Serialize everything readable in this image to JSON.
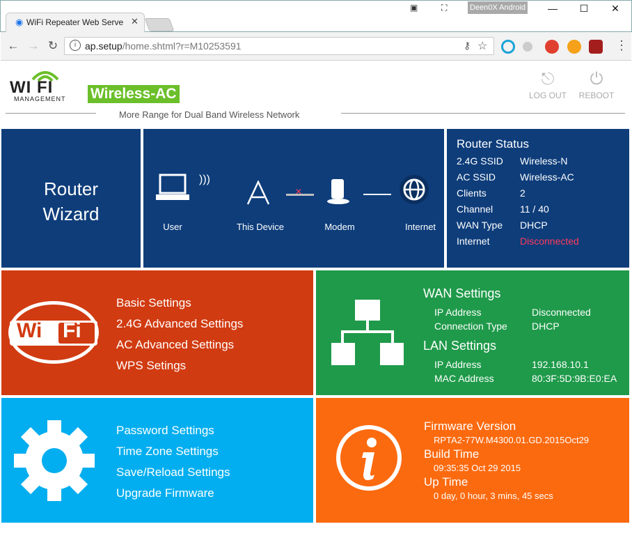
{
  "browser": {
    "tab_title": "WiFi Repeater Web Serve",
    "profile": "Deen0X Android",
    "url_host": "ap.setup",
    "url_path": "/home.shtml?r=M10253591",
    "minimize": "—",
    "maximize": "☐",
    "close": "✕"
  },
  "header": {
    "logo_text": "WI FI",
    "logo_sub": "MANAGEMENT",
    "badge": "Wireless-AC",
    "tagline": "More Range for Dual Band Wireless Network",
    "logout_label": "LOG OUT",
    "reboot_label": "REBOOT"
  },
  "wizard": {
    "line1": "Router",
    "line2": "Wizard"
  },
  "topology": {
    "user": "User",
    "device": "This Device",
    "modem": "Modem",
    "internet": "Internet"
  },
  "status": {
    "title": "Router Status",
    "rows": [
      {
        "key": "2.4G SSID",
        "value": "Wireless-N"
      },
      {
        "key": "AC SSID",
        "value": "Wireless-AC"
      },
      {
        "key": "Clients",
        "value": "2"
      },
      {
        "key": "Channel",
        "value": "11 / 40"
      },
      {
        "key": "WAN Type",
        "value": "DHCP"
      },
      {
        "key": "Internet",
        "value": "Disconnected"
      }
    ],
    "alert_color": "#ff3b5c"
  },
  "wifi_menu": {
    "icon_text_wi": "Wi",
    "icon_text_fi": "Fi",
    "items": [
      "Basic Settings",
      "2.4G Advanced Settings",
      "AC Advanced Settings",
      "WPS Setings"
    ]
  },
  "wan": {
    "title": "WAN Settings",
    "rows": [
      {
        "key": "IP Address",
        "value": "Disconnected"
      },
      {
        "key": "Connection Type",
        "value": "DHCP"
      }
    ]
  },
  "lan": {
    "title": "LAN Settings",
    "rows": [
      {
        "key": "IP Address",
        "value": "192.168.10.1"
      },
      {
        "key": "MAC Address",
        "value": "80:3F:5D:9B:E0:EA"
      }
    ]
  },
  "system_menu": {
    "items": [
      "Password Settings",
      "Time Zone Settings",
      "Save/Reload Settings",
      "Upgrade Firmware"
    ]
  },
  "info": {
    "firmware_title": "Firmware Version",
    "firmware_value": "RPTA2-77W.M4300.01.GD.2015Oct29",
    "build_title": "Build Time",
    "build_value": "09:35:35 Oct 29 2015",
    "uptime_title": "Up Time",
    "uptime_value": "0 day, 0 hour, 3 mins, 45 secs"
  },
  "colors": {
    "navy": "#0e3d7a",
    "red": "#d13b11",
    "green": "#1f9a4a",
    "blue": "#02aeef",
    "orange": "#fc6a0f",
    "badge_green": "#6bbf2a"
  }
}
